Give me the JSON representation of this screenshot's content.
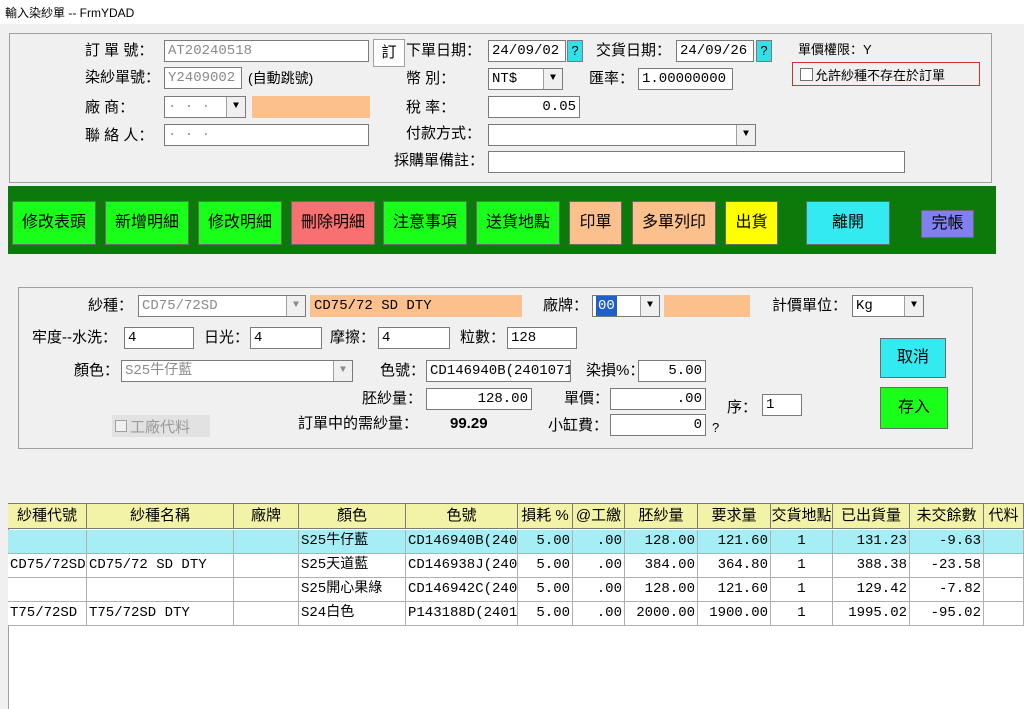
{
  "window": {
    "title": "輸入染紗單  --  FrmYDAD"
  },
  "header": {
    "order_no_label": "訂 單 號：",
    "order_no": "AT20240518",
    "order_btn": "訂",
    "order_date_label": "下單日期：",
    "order_date": "24/09/02",
    "delivery_date_label": "交貨日期：",
    "delivery_date": "24/09/26",
    "date_q": "?",
    "price_perm": "單價權限：Y",
    "allow_label": "允許紗種不存在於訂單",
    "dye_no_label": "染紗單號：",
    "dye_no": "Y2409002",
    "auto_no": "(自動跳號)",
    "currency_label": "幣    別：",
    "currency": "NT$",
    "rate_label": "匯率：",
    "rate": "1.00000000",
    "vendor_label": "廠    商：",
    "tax_label": "稅    率：",
    "tax": "0.05",
    "contact_label": "聯 絡 人：",
    "payment_label": "付款方式：",
    "payment": "",
    "remark_label": "採購單備註：",
    "remark": ""
  },
  "toolbar": [
    {
      "label": "修改表頭",
      "color": "#1aff1a"
    },
    {
      "label": "新增明細",
      "color": "#1aff1a"
    },
    {
      "label": "修改明細",
      "color": "#1aff1a"
    },
    {
      "label": "刪除明細",
      "color": "#f87171"
    },
    {
      "label": "注意事項",
      "color": "#1aff1a"
    },
    {
      "label": "送貨地點",
      "color": "#1aff1a"
    },
    {
      "label": "印單",
      "color": "#fcc08c"
    },
    {
      "label": "多單列印",
      "color": "#fcc08c"
    },
    {
      "label": "出貨",
      "color": "#ffff00"
    },
    {
      "label": "離開",
      "color": "#33eaf0"
    },
    {
      "label": "完帳",
      "color": "#8080f0"
    }
  ],
  "detail": {
    "yarn_label": "紗種：",
    "yarn_code": "CD75/72SD",
    "yarn_name": "CD75/72 SD DTY",
    "brand_label": "廠牌：",
    "brand_code": "00",
    "unit_label": "計價單位：",
    "unit": "Kg",
    "fastness_label": "牢度--水洗：",
    "wash": "4",
    "light_label": "日光：",
    "light": "4",
    "rub_label": "摩擦：",
    "rub": "4",
    "grains_label": "粒數：",
    "grains": "128",
    "color_label": "顏色：",
    "color": "S25牛仔藍",
    "colorno_label": "色號：",
    "colorno": "CD146940B(240107123",
    "loss_label": "染損%：",
    "loss": "5.00",
    "greige_label": "胚紗量：",
    "greige": "128.00",
    "price_label": "單價：",
    "price": ".00",
    "seq_label": "序：",
    "seq": "1",
    "need_label": "訂單中的需紗量：",
    "need": "99.29",
    "vat_label": "小缸費：",
    "vat": "0",
    "vat_q": "?",
    "factory_label": "工廠代料",
    "cancel": "取消",
    "save": "存入"
  },
  "grid": {
    "headers": [
      "紗種代號",
      "紗種名稱",
      "廠牌",
      "顏色",
      "色號",
      "損耗 %",
      "@工繳",
      "胚紗量",
      "要求量",
      "交貨地點",
      "已出貨量",
      "未交餘數",
      "代料"
    ],
    "rows": [
      {
        "code": "",
        "name": "",
        "brand": "",
        "color": "S25牛仔藍",
        "colorno": "CD146940B(2401",
        "loss": "5.00",
        "fee": ".00",
        "greige": "128.00",
        "req": "121.60",
        "place": "1",
        "shipped": "131.23",
        "remain": "-9.63",
        "sub": ""
      },
      {
        "code": "CD75/72SD",
        "name": "CD75/72 SD DTY",
        "brand": "",
        "color": "S25天道藍",
        "colorno": "CD146938J(2401",
        "loss": "5.00",
        "fee": ".00",
        "greige": "384.00",
        "req": "364.80",
        "place": "1",
        "shipped": "388.38",
        "remain": "-23.58",
        "sub": ""
      },
      {
        "code": "",
        "name": "",
        "brand": "",
        "color": "S25開心果綠",
        "colorno": "CD146942C(2401",
        "loss": "5.00",
        "fee": ".00",
        "greige": "128.00",
        "req": "121.60",
        "place": "1",
        "shipped": "129.42",
        "remain": "-7.82",
        "sub": ""
      },
      {
        "code": "T75/72SD",
        "name": "T75/72SD DTY",
        "brand": "",
        "color": "S24白色",
        "colorno": "P143188D(24010",
        "loss": "5.00",
        "fee": ".00",
        "greige": "2000.00",
        "req": "1900.00",
        "place": "1",
        "shipped": "1995.02",
        "remain": "-95.02",
        "sub": ""
      }
    ]
  }
}
